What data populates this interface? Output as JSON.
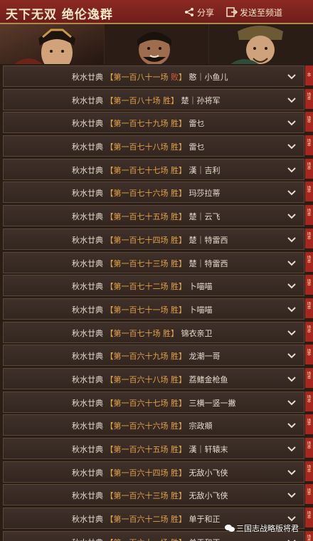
{
  "header": {
    "title": "天下无双  绝伦逸群",
    "share_label": "分享",
    "send_label": "发送至频道"
  },
  "portraits": [
    {
      "name": "portrait-1"
    },
    {
      "name": "portrait-2"
    },
    {
      "name": "portrait-3"
    }
  ],
  "rows": [
    {
      "prefix": "秋水廿典",
      "match": "第一百八十一场",
      "result": "败",
      "player": "憨｜小鱼儿"
    },
    {
      "prefix": "秋水廿典",
      "match": "第一百八十场",
      "result": "胜",
      "player": "楚｜孙将军"
    },
    {
      "prefix": "秋水廿典",
      "match": "第一百七十九场",
      "result": "胜",
      "player": "雷乜"
    },
    {
      "prefix": "秋水廿典",
      "match": "第一百七十八场",
      "result": "胜",
      "player": "雷乜"
    },
    {
      "prefix": "秋水廿典",
      "match": "第一百七十七场",
      "result": "胜",
      "player": "漢｜吉利"
    },
    {
      "prefix": "秋水廿典",
      "match": "第一百七十六场",
      "result": "胜",
      "player": "玛莎拉蒂"
    },
    {
      "prefix": "秋水廿典",
      "match": "第一百七十五场",
      "result": "胜",
      "player": "楚｜云飞"
    },
    {
      "prefix": "秋水廿典",
      "match": "第一百七十四场",
      "result": "胜",
      "player": "楚｜特雷西"
    },
    {
      "prefix": "秋水廿典",
      "match": "第一百七十三场",
      "result": "胜",
      "player": "楚｜特雷西"
    },
    {
      "prefix": "秋水廿典",
      "match": "第一百七十二场",
      "result": "胜",
      "player": "卜喵喵"
    },
    {
      "prefix": "秋水廿典",
      "match": "第一百七十一场",
      "result": "胜",
      "player": "卜喵喵"
    },
    {
      "prefix": "秋水廿典",
      "match": "第一百七十场",
      "result": "胜",
      "player": "锦衣亲卫"
    },
    {
      "prefix": "秋水廿典",
      "match": "第一百六十九场",
      "result": "胜",
      "player": "龙潮一哥"
    },
    {
      "prefix": "秋水廿典",
      "match": "第一百六十八场",
      "result": "胜",
      "player": "荔鳍金枪鱼"
    },
    {
      "prefix": "秋水廿典",
      "match": "第一百六十七场",
      "result": "胜",
      "player": "三横一竖一撇"
    },
    {
      "prefix": "秋水廿典",
      "match": "第一百六十六场",
      "result": "胜",
      "player": "宗政頫"
    },
    {
      "prefix": "秋水廿典",
      "match": "第一百六十五场",
      "result": "胜",
      "player": "漢｜轩辕末"
    },
    {
      "prefix": "秋水廿典",
      "match": "第一百六十四场",
      "result": "胜",
      "player": "无敌小飞侠"
    },
    {
      "prefix": "秋水廿典",
      "match": "第一百六十三场",
      "result": "胜",
      "player": "无敌小飞侠"
    },
    {
      "prefix": "秋水廿典",
      "match": "第一百六十二场",
      "result": "胜",
      "player": "单于和正"
    },
    {
      "prefix": "秋水廿典",
      "match": "第一百六十一场",
      "result": "胜",
      "player": "单于和正"
    }
  ],
  "side_tag": "本场",
  "watermark": "三国志战略版将君",
  "colors": {
    "header_bg": "#7a2420",
    "row_bg": "#3a2c25",
    "accent": "#e0a24a",
    "loss": "#e05a3a"
  }
}
